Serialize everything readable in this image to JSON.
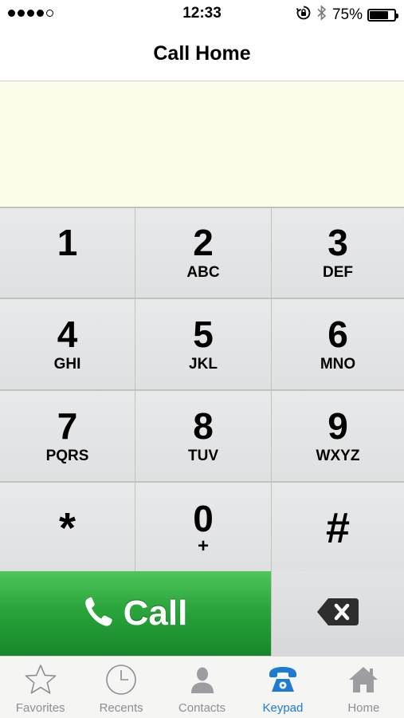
{
  "status_bar": {
    "time": "12:33",
    "battery_text": "75%",
    "battery_level": 0.75,
    "signal_dots_filled": 4,
    "signal_dots_total": 5
  },
  "header": {
    "title": "Call Home"
  },
  "display": {
    "number": ""
  },
  "keypad": {
    "keys": [
      {
        "digit": "1",
        "letters": ""
      },
      {
        "digit": "2",
        "letters": "ABC"
      },
      {
        "digit": "3",
        "letters": "DEF"
      },
      {
        "digit": "4",
        "letters": "GHI"
      },
      {
        "digit": "5",
        "letters": "JKL"
      },
      {
        "digit": "6",
        "letters": "MNO"
      },
      {
        "digit": "7",
        "letters": "PQRS"
      },
      {
        "digit": "8",
        "letters": "TUV"
      },
      {
        "digit": "9",
        "letters": "WXYZ"
      },
      {
        "digit": "*",
        "letters": ""
      },
      {
        "digit": "0",
        "letters": "+"
      },
      {
        "digit": "#",
        "letters": ""
      }
    ]
  },
  "actions": {
    "call_label": "Call"
  },
  "tabs": [
    {
      "label": "Favorites",
      "icon": "star-icon"
    },
    {
      "label": "Recents",
      "icon": "clock-icon"
    },
    {
      "label": "Contacts",
      "icon": "contact-icon"
    },
    {
      "label": "Keypad",
      "icon": "keypad-phone-icon",
      "active": true
    },
    {
      "label": "Home",
      "icon": "home-icon"
    }
  ],
  "colors": {
    "display_bg": "#fcfdea",
    "call_green": "#2aa53b",
    "active_tab": "#1e7bd4",
    "inactive_tab": "#8e8e93"
  }
}
